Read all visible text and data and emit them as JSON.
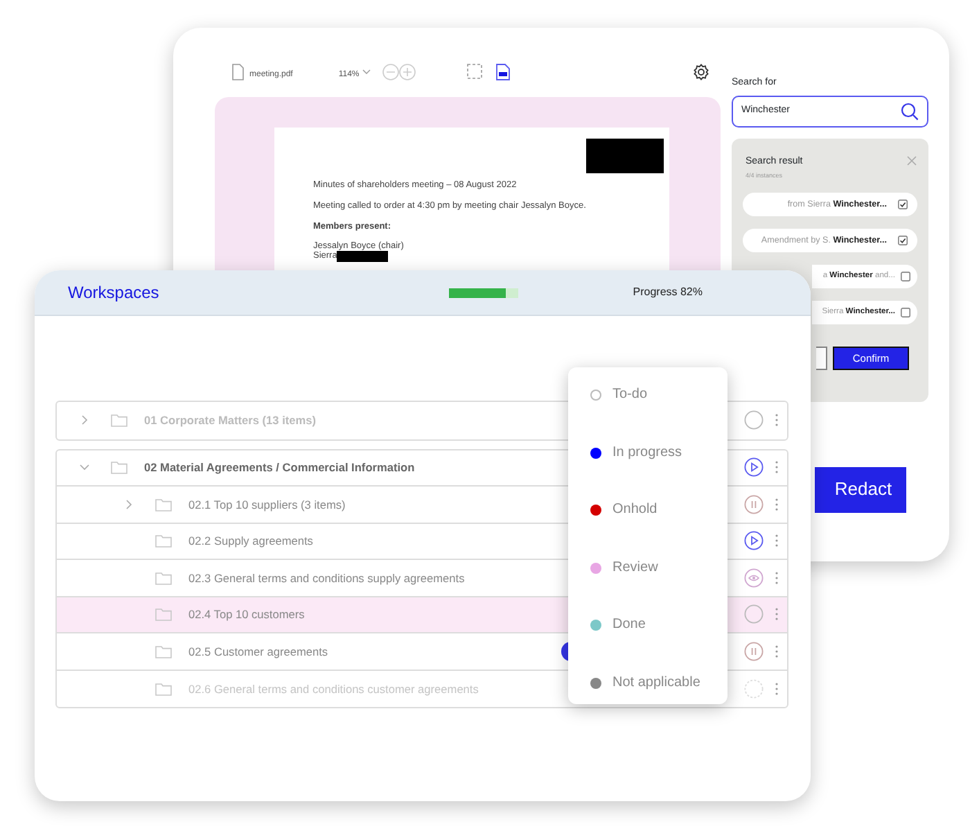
{
  "document_viewer": {
    "file_name": "meeting.pdf",
    "zoom": "114%",
    "lines": [
      {
        "kind": "text",
        "text": "Minutes of shareholders meeting – 08 August 2022"
      },
      {
        "kind": "text",
        "text": "Meeting called to order at 4:30 pm by meeting chair Jessalyn Boyce."
      },
      {
        "kind": "heading",
        "text": "Members present:"
      },
      {
        "kind": "member",
        "text": "Jessalyn Boyce (chair)"
      },
      {
        "kind": "redacted_member",
        "text": "Sierra"
      }
    ]
  },
  "search": {
    "label": "Search for",
    "value": "Winchester"
  },
  "search_results": {
    "title": "Search result",
    "count": "4/4 instances",
    "items": [
      {
        "text": "from Sierra **Winchester...**",
        "checked": true
      },
      {
        "text": "Amendment by S. **Winchester...**",
        "checked": true
      },
      {
        "text": "a **Winchester** and...",
        "checked": false
      },
      {
        "text": "Sierra **Winchester...**",
        "checked": false
      }
    ],
    "confirm_button": "Confirm"
  },
  "redact_button": "Redact",
  "workspaces": {
    "title": "Workspaces",
    "progress": {
      "level": 0.82,
      "label": "Progress 82%"
    },
    "folders": [
      {
        "label": "01 Corporate Matters (13 items)",
        "expanded": false,
        "disabled": true,
        "selected": false,
        "assigned": false,
        "kind": "todo"
      },
      {
        "label": "02 Material Agreements / Commercial Information",
        "expanded": true,
        "disabled": false,
        "selected": false,
        "assigned": false,
        "kind": "in_progress",
        "children": [
          {
            "label": "02.1 Top 10 suppliers (3 items)",
            "expanded": false,
            "disabled": false,
            "selected": false,
            "assigned": false,
            "kind": "on_hold"
          },
          {
            "label": "02.2 Supply agreements",
            "disabled": false,
            "selected": false,
            "assigned": false,
            "kind": "in_progress"
          },
          {
            "label": "02.3 General terms and conditions supply agreements",
            "disabled": false,
            "selected": false,
            "assigned": false,
            "kind": "review"
          },
          {
            "label": "02.4 Top 10 customers",
            "disabled": false,
            "selected": true,
            "assigned": false,
            "kind": "todo"
          },
          {
            "label": "02.5 Customer agreements",
            "disabled": false,
            "selected": false,
            "assigned": true,
            "kind": "on_hold"
          },
          {
            "label": "02.6 General terms and conditions customer agreements",
            "disabled": true,
            "selected": false,
            "assigned": false,
            "kind": "none"
          }
        ]
      }
    ]
  },
  "status_menu": [
    {
      "label": "To-do",
      "color": "#ffffff"
    },
    {
      "label": "In progress",
      "color": "#0000ff"
    },
    {
      "label": "Onhold",
      "color": "#d40000"
    },
    {
      "label": "Review",
      "color": "#e8a6e4"
    },
    {
      "label": "Done",
      "color": "#7cc8c8"
    },
    {
      "label": "Not applicable",
      "color": "#888888"
    }
  ]
}
